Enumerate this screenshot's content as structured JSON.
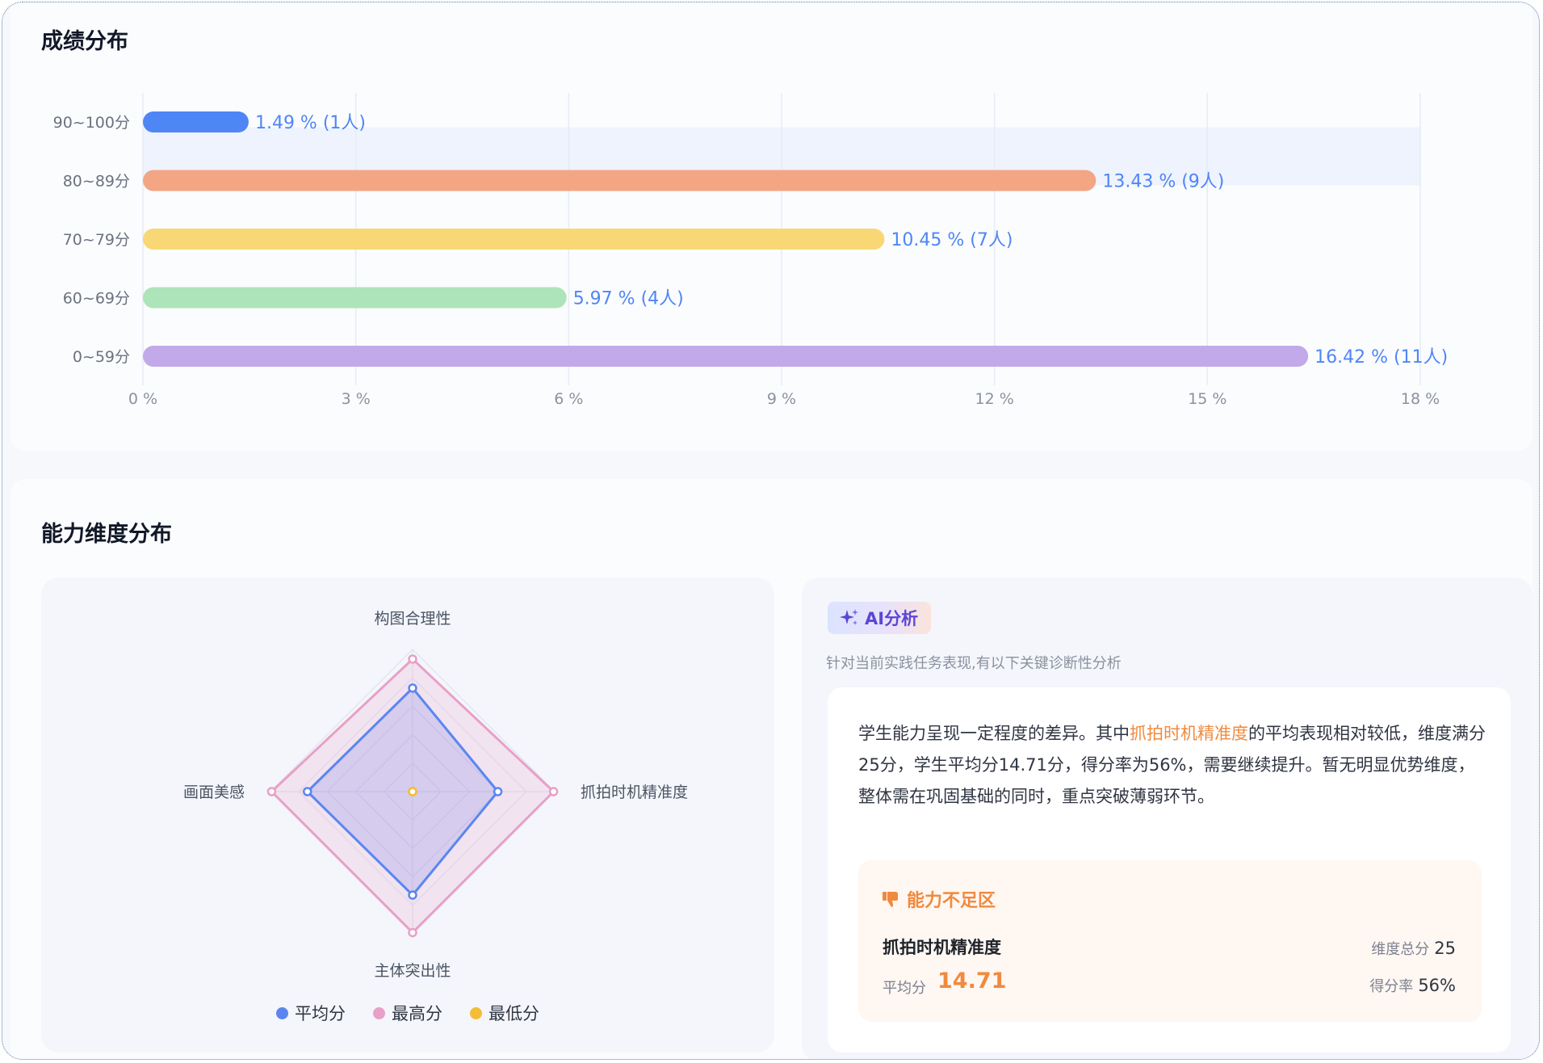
{
  "sections": {
    "score_distribution_title": "成绩分布",
    "ability_title": "能力维度分布"
  },
  "chart_data": [
    {
      "type": "bar",
      "orientation": "horizontal",
      "title": "成绩分布",
      "categories": [
        "90~100分",
        "80~89分",
        "70~79分",
        "60~69分",
        "0~59分"
      ],
      "values": [
        1.49,
        13.43,
        10.45,
        5.97,
        16.42
      ],
      "counts": [
        1,
        9,
        7,
        4,
        11
      ],
      "data_labels": [
        "1.49 % (1人)",
        "13.43 % (9人)",
        "10.45 % (7人)",
        "5.97 % (4人)",
        "16.42 % (11人)"
      ],
      "colors": [
        "#4f86f5",
        "#f3a584",
        "#f8d875",
        "#ade4b9",
        "#c2a9ea"
      ],
      "xlim": [
        0,
        18
      ],
      "xticks": [
        0,
        3,
        6,
        9,
        12,
        15,
        18
      ],
      "xtick_labels": [
        "0 %",
        "3 %",
        "6 %",
        "9 %",
        "12 %",
        "15 %",
        "18 %"
      ],
      "highlighted_category": "80~89分",
      "grid": true,
      "label_color": "#4f86f5"
    },
    {
      "type": "radar",
      "axes": [
        "构图合理性",
        "抓拍时机精准度",
        "主体突出性",
        "画面美感"
      ],
      "max": 25,
      "series": [
        {
          "name": "平均分",
          "color": "#5b86f0",
          "values": [
            18.2,
            15.0,
            18.2,
            18.5
          ]
        },
        {
          "name": "最高分",
          "color": "#e8a0c8",
          "values": [
            23.3,
            24.8,
            24.8,
            24.8
          ]
        },
        {
          "name": "最低分",
          "color": "#f5bd37",
          "values": [
            0,
            0,
            0,
            0
          ]
        }
      ],
      "legend_position": "bottom"
    }
  ],
  "ai": {
    "badge": "AI分析",
    "subtitle": "针对当前实践任务表现,有以下关键诊断性分析",
    "text_before": "学生能力呈现一定程度的差异。其中",
    "text_highlight": "抓拍时机精准度",
    "text_after": "的平均表现相对较低，维度满分25分，学生平均分14.71分，得分率为56%，需要继续提升。暂无明显优势维度，整体需在巩固基础的同时，重点突破薄弱环节。",
    "weak_area": {
      "title": "能力不足区",
      "dimension": "抓拍时机精准度",
      "avg_label": "平均分",
      "avg_value": "14.71",
      "total_label": "维度总分",
      "total_value": "25",
      "rate_label": "得分率",
      "rate_value": "56%"
    }
  },
  "colors": {
    "accent_orange": "#f08a3e",
    "ai_purple": "#5a46d6"
  }
}
